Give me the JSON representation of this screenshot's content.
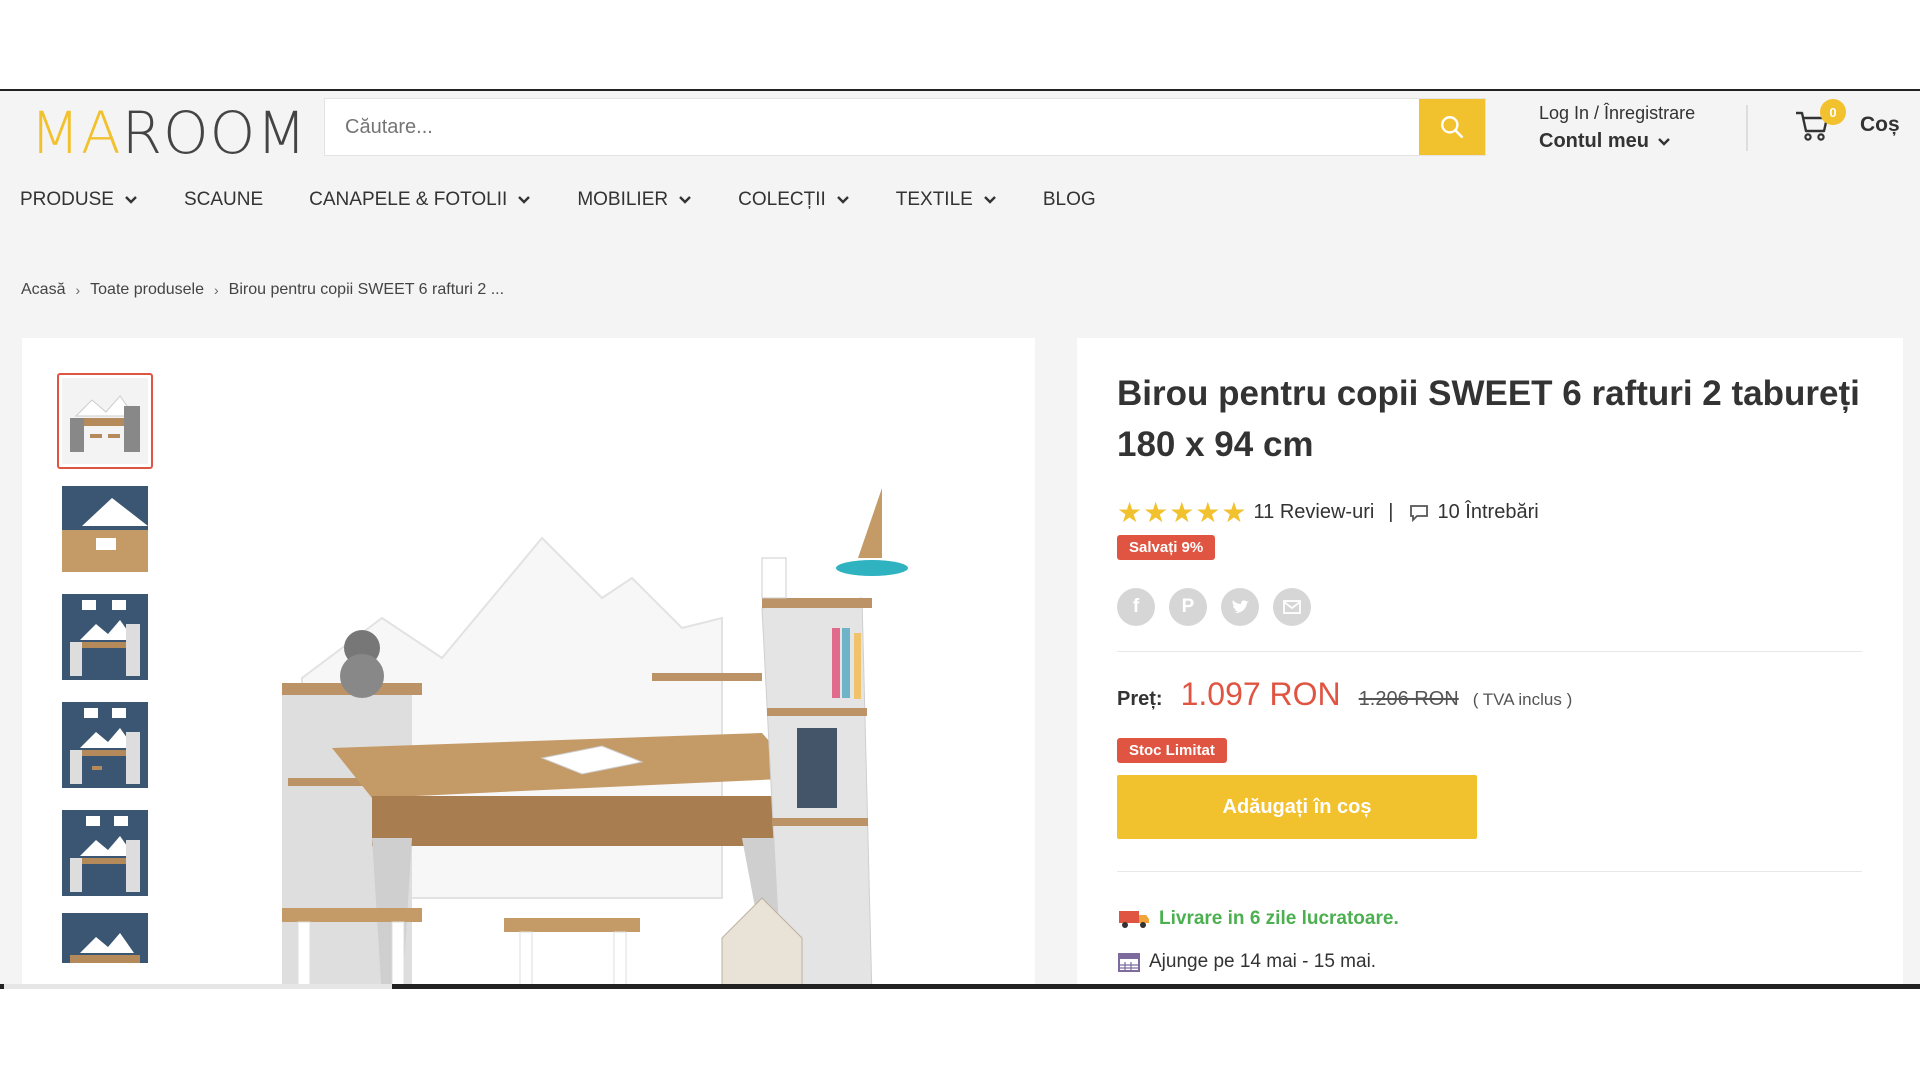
{
  "logo": {
    "ma": "MA",
    "room": "ROOM"
  },
  "search": {
    "placeholder": "Căutare..."
  },
  "account": {
    "login": "Log In / Înregistrare",
    "my_account": "Contul meu"
  },
  "cart": {
    "count": "0",
    "label": "Coș"
  },
  "nav": {
    "items": [
      {
        "label": "PRODUSE",
        "dropdown": true
      },
      {
        "label": "SCAUNE",
        "dropdown": false
      },
      {
        "label": "CANAPELE & FOTOLII",
        "dropdown": true
      },
      {
        "label": "MOBILIER",
        "dropdown": true
      },
      {
        "label": "COLECȚII",
        "dropdown": true
      },
      {
        "label": "TEXTILE",
        "dropdown": true
      },
      {
        "label": "BLOG",
        "dropdown": false
      }
    ]
  },
  "breadcrumb": {
    "home": "Acasă",
    "all": "Toate produsele",
    "current": "Birou pentru copii SWEET 6 rafturi 2 ..."
  },
  "product": {
    "title": "Birou pentru copii SWEET 6 rafturi 2 taburеți 180 x 94 cm",
    "rating": 5,
    "reviews": "11 Review-uri",
    "questions": "10 Întrebări",
    "save_badge": "Salvați 9%",
    "price_label": "Preț:",
    "price": "1.097 RON",
    "old_price": "1.206 RON",
    "vat": "( TVA inclus )",
    "stock_badge": "Stoc Limitat",
    "add_to_cart": "Adăugați în coș",
    "delivery": "Livrare in 6 zile lucratoare.",
    "arrival": "Ajunge pe 14 mai - 15 mai."
  },
  "share": [
    "facebook",
    "pinterest",
    "twitter",
    "email"
  ],
  "colors": {
    "accent": "#f2c12e",
    "sale": "#e05542",
    "delivery": "#4caf50"
  }
}
